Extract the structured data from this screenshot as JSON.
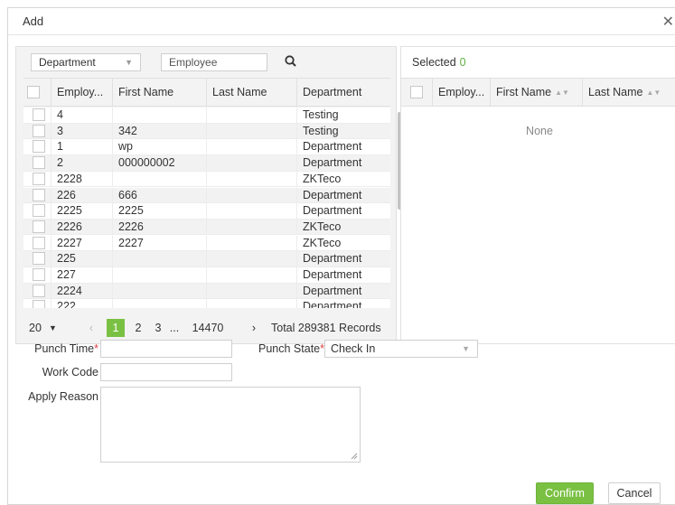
{
  "dialog": {
    "title": "Add"
  },
  "filters": {
    "department": "Department",
    "employee_placeholder": "Employee"
  },
  "left_table": {
    "columns": [
      "Employ...",
      "First Name",
      "Last Name",
      "Department"
    ],
    "rows": [
      {
        "id": "4",
        "first": "",
        "last": "",
        "dept": "Testing"
      },
      {
        "id": "3",
        "first": "342",
        "last": "",
        "dept": "Testing"
      },
      {
        "id": "1",
        "first": "wp",
        "last": "",
        "dept": "Department"
      },
      {
        "id": "2",
        "first": "000000002",
        "last": "",
        "dept": "Department"
      },
      {
        "id": "2228",
        "first": "",
        "last": "",
        "dept": "ZKTeco"
      },
      {
        "id": "226",
        "first": "666",
        "last": "",
        "dept": "Department"
      },
      {
        "id": "2225",
        "first": "2225",
        "last": "",
        "dept": "Department"
      },
      {
        "id": "2226",
        "first": "2226",
        "last": "",
        "dept": "ZKTeco"
      },
      {
        "id": "2227",
        "first": "2227",
        "last": "",
        "dept": "ZKTeco"
      },
      {
        "id": "225",
        "first": "",
        "last": "",
        "dept": "Department"
      },
      {
        "id": "227",
        "first": "",
        "last": "",
        "dept": "Department"
      },
      {
        "id": "2224",
        "first": "",
        "last": "",
        "dept": "Department"
      },
      {
        "id": "222",
        "first": "",
        "last": "",
        "dept": "Department"
      }
    ]
  },
  "pager": {
    "page_size": "20",
    "pages": [
      "1",
      "2",
      "3",
      "...",
      "14470"
    ],
    "total": "Total 289381 Records"
  },
  "selected": {
    "title": "Selected",
    "count": "0",
    "columns": [
      "Employ...",
      "First Name",
      "Last Name"
    ],
    "empty": "None"
  },
  "form": {
    "punch_time_label": "Punch Time",
    "punch_state_label": "Punch State",
    "punch_state_value": "Check In",
    "work_code_label": "Work Code",
    "apply_reason_label": "Apply Reason",
    "required_mark": "*"
  },
  "buttons": {
    "confirm": "Confirm",
    "cancel": "Cancel"
  },
  "colors": {
    "accent": "#7ac143",
    "required": "#e04040",
    "count": "#5fb040"
  }
}
